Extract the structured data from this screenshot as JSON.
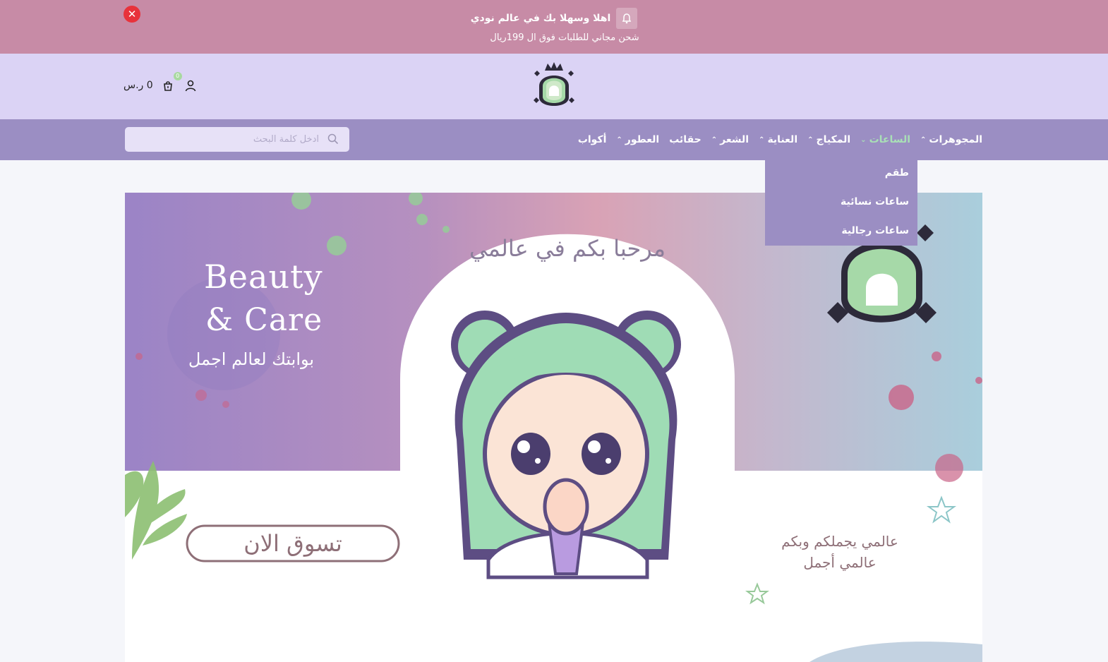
{
  "announcement": {
    "title": "اهلا وسهلا بك في عالم نودي",
    "subtitle": "شحن مجاني للطلبات فوق ال 199ريال"
  },
  "header": {
    "cart_price": "0 ر.س",
    "cart_count": "0"
  },
  "search": {
    "placeholder": "ادخل كلمة البحث"
  },
  "nav": {
    "items": [
      {
        "label": "المجوهرات"
      },
      {
        "label": "الساعات"
      },
      {
        "label": "المكياج"
      },
      {
        "label": "العناية"
      },
      {
        "label": "الشعر"
      },
      {
        "label": "حقائب"
      },
      {
        "label": "العطور"
      },
      {
        "label": "أكواب"
      }
    ]
  },
  "dropdown": {
    "items": [
      {
        "label": "طقم"
      },
      {
        "label": "ساعات نسائية"
      },
      {
        "label": "ساعات رجالية"
      }
    ]
  },
  "hero": {
    "line1": "Beauty",
    "line2": "& Care",
    "tagline": "بوابتك لعالم اجمل",
    "arc_text": "مرحبا بكم في عالمي",
    "cta": "تسوق الان",
    "slogan1": "عالمي يجملكم وبكم",
    "slogan2": "عالمي أجمل"
  },
  "colors": {
    "announcement_bg": "#c78ba6",
    "header_bg": "#dbd3f5",
    "nav_bg": "#9b8ec3",
    "nav_active": "#a9e0b6",
    "close_red": "#e8323b"
  }
}
